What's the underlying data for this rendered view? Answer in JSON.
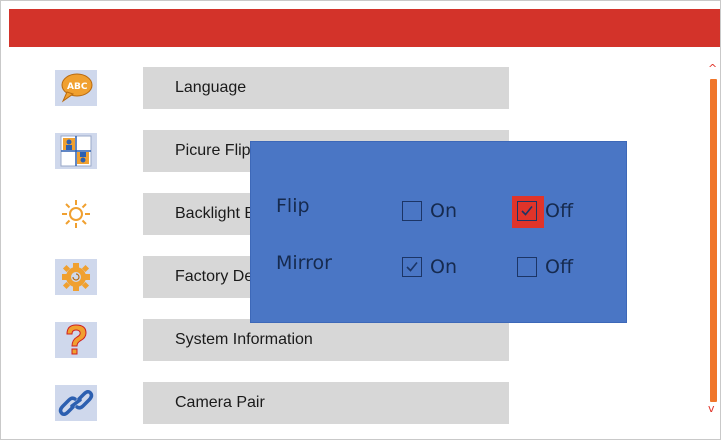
{
  "menu": {
    "items": [
      {
        "label": "Language",
        "icon": "abc-speech-icon"
      },
      {
        "label": "Picure Flip",
        "icon": "picture-flip-icon"
      },
      {
        "label": "Backlight Brightness",
        "icon": "brightness-icon"
      },
      {
        "label": "Factory Default",
        "icon": "gear-reset-icon"
      },
      {
        "label": "System Information",
        "icon": "question-icon"
      },
      {
        "label": "Camera Pair",
        "icon": "link-icon"
      }
    ]
  },
  "popup": {
    "flip": {
      "label": "Flip",
      "on": "On",
      "off": "Off",
      "selected": "Off"
    },
    "mirror": {
      "label": "Mirror",
      "on": "On",
      "off": "Off",
      "selected": "On"
    }
  },
  "scroll": {
    "up_arrow": "^",
    "down_arrow": "v"
  },
  "colors": {
    "header": "#d3332a",
    "popup_bg": "#4a76c5",
    "scrollbar": "#f0762a",
    "selection": "#e0342a"
  }
}
